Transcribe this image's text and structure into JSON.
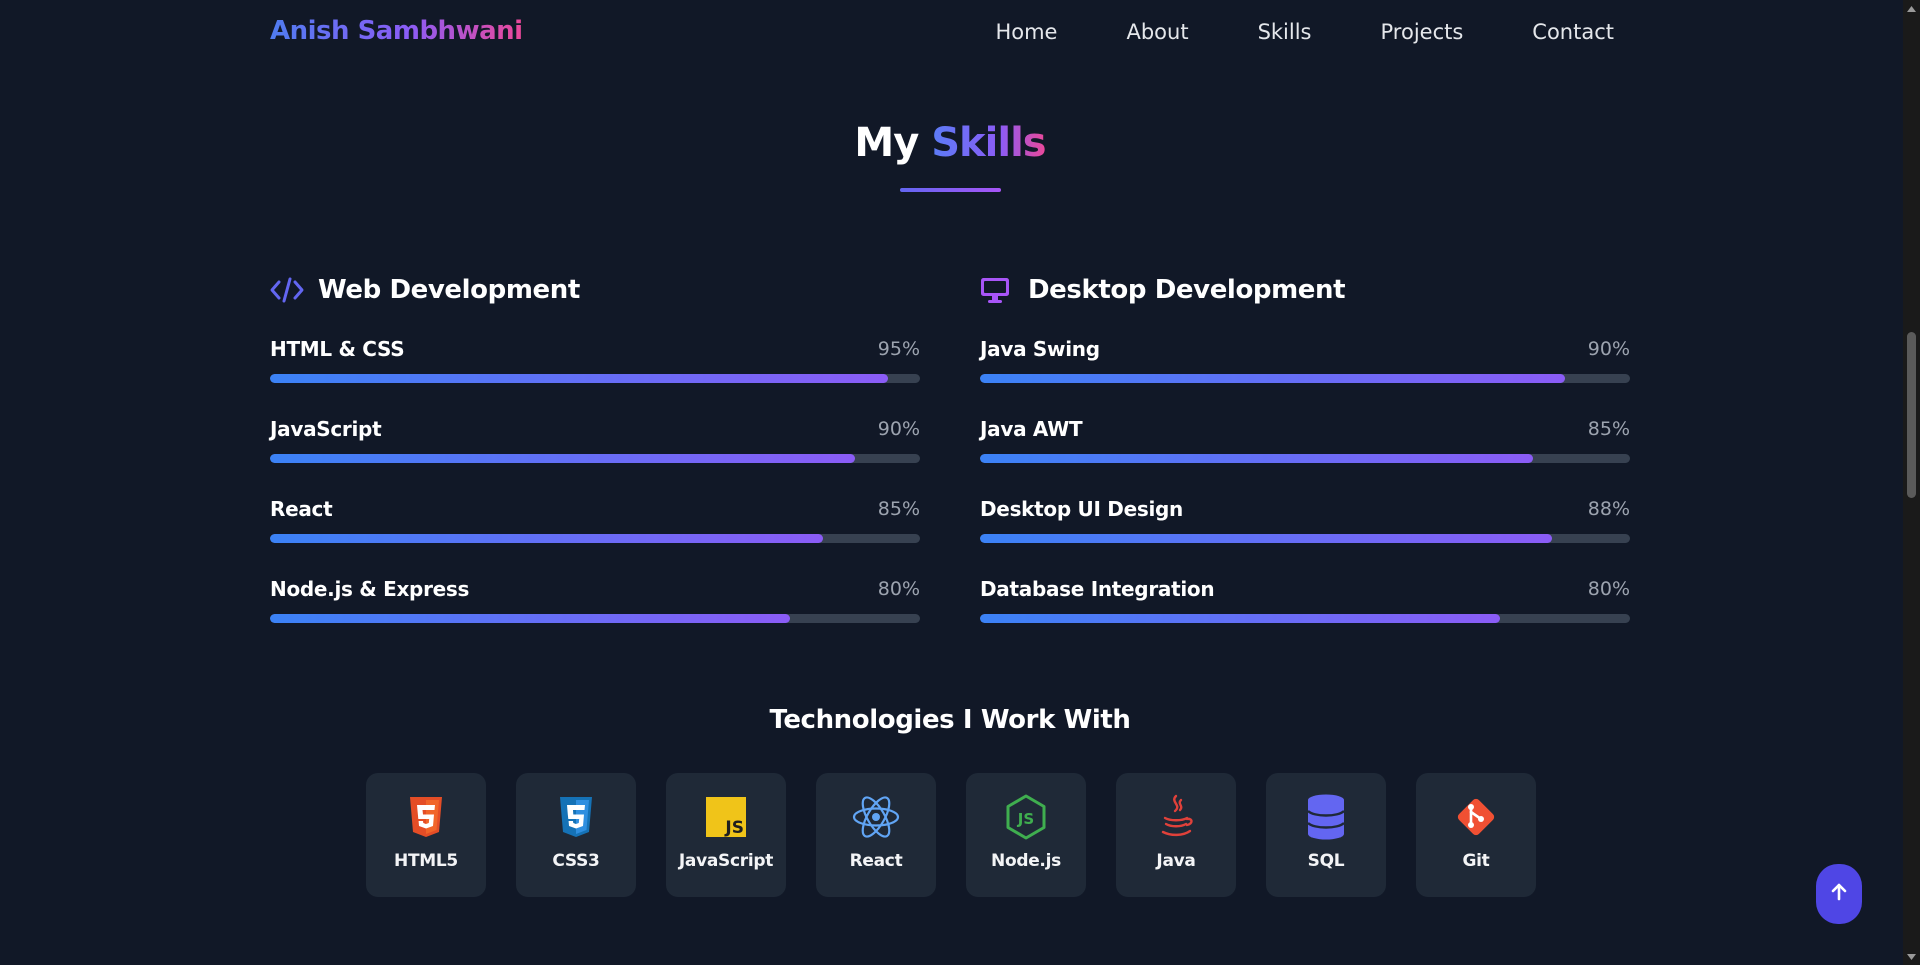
{
  "nav": {
    "brand": "Anish Sambhwani",
    "links": [
      "Home",
      "About",
      "Skills",
      "Projects",
      "Contact"
    ]
  },
  "section": {
    "title_plain": "My",
    "title_highlight": "Skills"
  },
  "web": {
    "title": "Web Development",
    "icon": "code-icon",
    "skills": [
      {
        "name": "HTML & CSS",
        "percent_label": "95%",
        "level": 95
      },
      {
        "name": "JavaScript",
        "percent_label": "90%",
        "level": 90
      },
      {
        "name": "React",
        "percent_label": "85%",
        "level": 85
      },
      {
        "name": "Node.js & Express",
        "percent_label": "80%",
        "level": 80
      }
    ]
  },
  "desktop": {
    "title": "Desktop Development",
    "icon": "desktop-icon",
    "skills": [
      {
        "name": "Java Swing",
        "percent_label": "90%",
        "level": 90
      },
      {
        "name": "Java AWT",
        "percent_label": "85%",
        "level": 85
      },
      {
        "name": "Desktop UI Design",
        "percent_label": "88%",
        "level": 88
      },
      {
        "name": "Database Integration",
        "percent_label": "80%",
        "level": 80
      }
    ]
  },
  "technologies": {
    "title": "Technologies I Work With",
    "items": [
      {
        "label": "HTML5",
        "icon": "html5-icon",
        "color": "#f16529"
      },
      {
        "label": "CSS3",
        "icon": "css3-icon",
        "color": "#2f7fe0"
      },
      {
        "label": "JavaScript",
        "icon": "javascript-icon",
        "color": "#f0c419"
      },
      {
        "label": "React",
        "icon": "react-icon",
        "color": "#61a5f5"
      },
      {
        "label": "Node.js",
        "icon": "nodejs-icon",
        "color": "#3fae4f"
      },
      {
        "label": "Java",
        "icon": "java-icon",
        "color": "#e0413a"
      },
      {
        "label": "SQL",
        "icon": "database-icon",
        "color": "#6366f1"
      },
      {
        "label": "Git",
        "icon": "git-icon",
        "color": "#f05033"
      }
    ]
  },
  "colors": {
    "background": "#111827",
    "card": "#1f2937",
    "track": "#374151",
    "accent": "#4f46e5"
  }
}
